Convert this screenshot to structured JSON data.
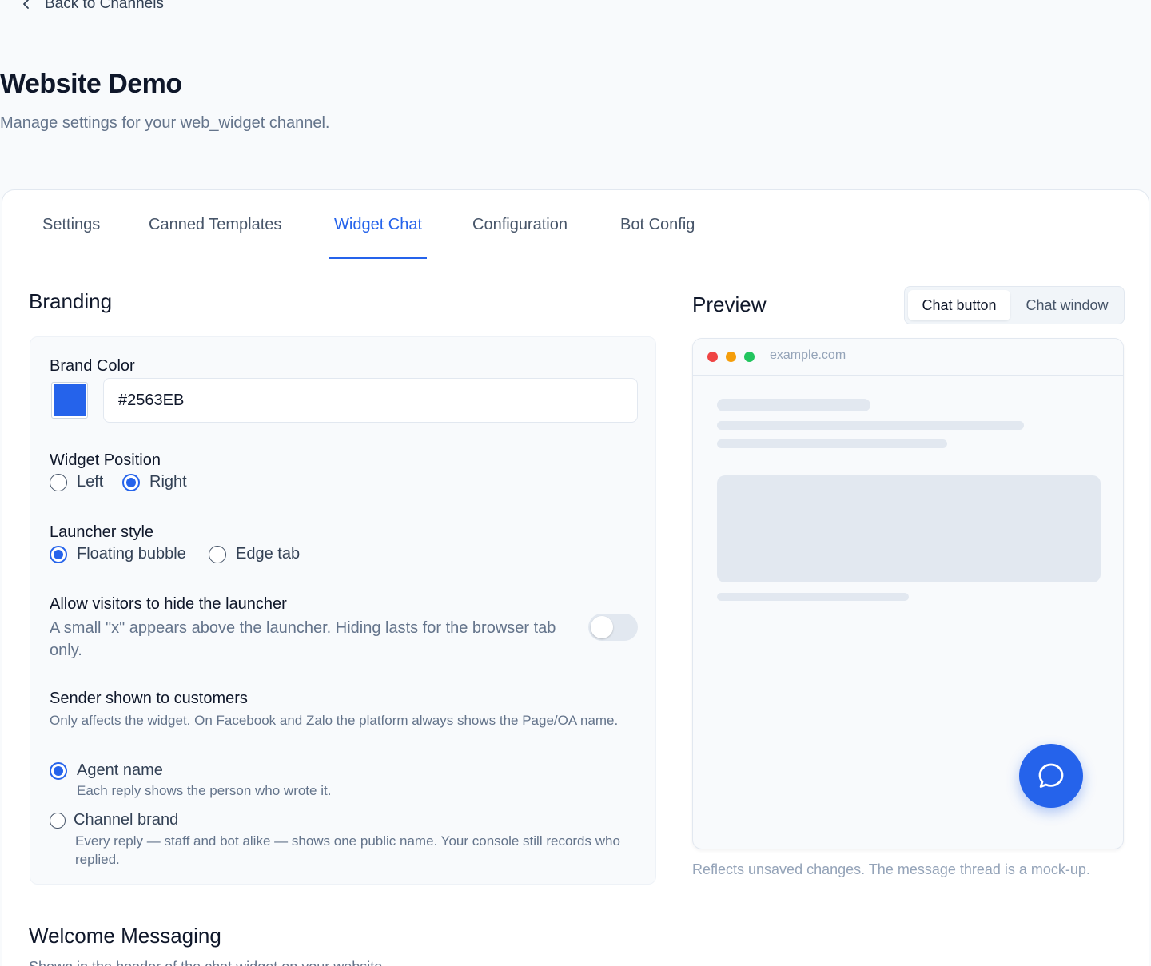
{
  "nav": {
    "back_label": "Back to Channels"
  },
  "header": {
    "title": "Website Demo",
    "subtitle": "Manage settings for your web_widget channel."
  },
  "tabs": [
    {
      "label": "Settings"
    },
    {
      "label": "Canned Templates"
    },
    {
      "label": "Widget Chat"
    },
    {
      "label": "Configuration"
    },
    {
      "label": "Bot Config"
    }
  ],
  "active_tab": "Widget Chat",
  "branding": {
    "heading": "Branding",
    "brand_color_label": "Brand Color",
    "brand_color_value": "#2563EB",
    "widget_position": {
      "label": "Widget Position",
      "options": [
        "Left",
        "Right"
      ],
      "selected": "Right"
    },
    "launcher_style": {
      "label": "Launcher style",
      "options": [
        "Floating bubble",
        "Edge tab"
      ],
      "selected": "Floating bubble"
    },
    "hide_launcher": {
      "label": "Allow visitors to hide the launcher",
      "help": "A small \"x\" appears above the launcher. Hiding lasts for the browser tab only.",
      "enabled": false
    },
    "sender": {
      "label": "Sender shown to customers",
      "help": "Only affects the widget. On Facebook and Zalo the platform always shows the Page/OA name.",
      "options": [
        {
          "label": "Agent name",
          "help": "Each reply shows the person who wrote it."
        },
        {
          "label": "Channel brand",
          "help": "Every reply — staff and bot alike — shows one public name. Your console still records who replied."
        }
      ],
      "selected": "Agent name"
    }
  },
  "preview": {
    "heading": "Preview",
    "modes": [
      "Chat button",
      "Chat window"
    ],
    "selected_mode": "Chat button",
    "url": "example.com",
    "note": "Reflects unsaved changes. The message thread is a mock-up.",
    "dot_colors": [
      "#ef4444",
      "#f59e0b",
      "#22c55e"
    ],
    "launcher_icon": "chat-bubble-icon"
  },
  "welcome": {
    "heading": "Welcome Messaging",
    "help": "Shown in the header of the chat widget on your website."
  },
  "colors": {
    "accent": "#2563eb",
    "muted_text": "#64748b"
  }
}
